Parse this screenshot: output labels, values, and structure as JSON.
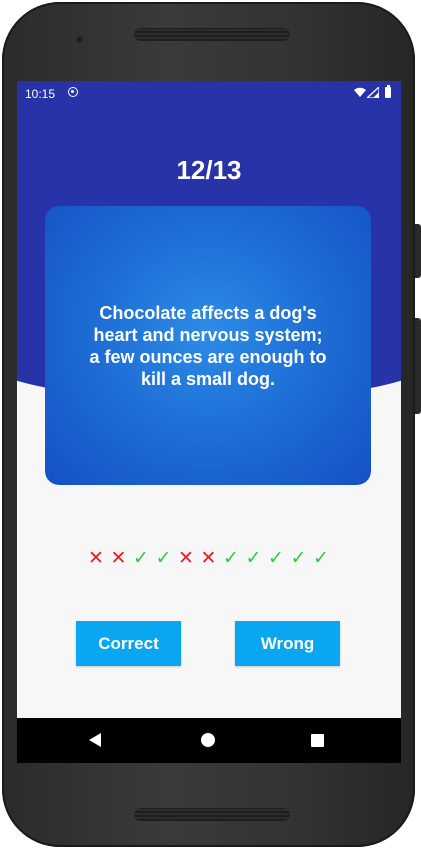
{
  "status_bar": {
    "time": "10:15",
    "icons": [
      "sync-icon",
      "wifi-icon",
      "signal-icon",
      "battery-icon"
    ]
  },
  "quiz": {
    "progress": "12/13",
    "statement": "Chocolate affects a dog's heart and nervous system; a few ounces are enough to kill a small dog.",
    "history": [
      "wrong",
      "wrong",
      "correct",
      "correct",
      "wrong",
      "wrong",
      "correct",
      "correct",
      "correct",
      "correct",
      "correct"
    ],
    "history_glyphs": {
      "wrong": "✕",
      "correct": "✓"
    }
  },
  "buttons": {
    "correct_label": "Correct",
    "wrong_label": "Wrong"
  },
  "colors": {
    "header_blue": "#2833a8",
    "card_blue": "#1f6fd6",
    "button_blue": "#0aa6ef",
    "wrong_red": "#e8202a",
    "correct_green": "#2ecc40"
  },
  "navigation": {
    "icons": [
      "back-icon",
      "home-icon",
      "recent-apps-icon"
    ]
  }
}
